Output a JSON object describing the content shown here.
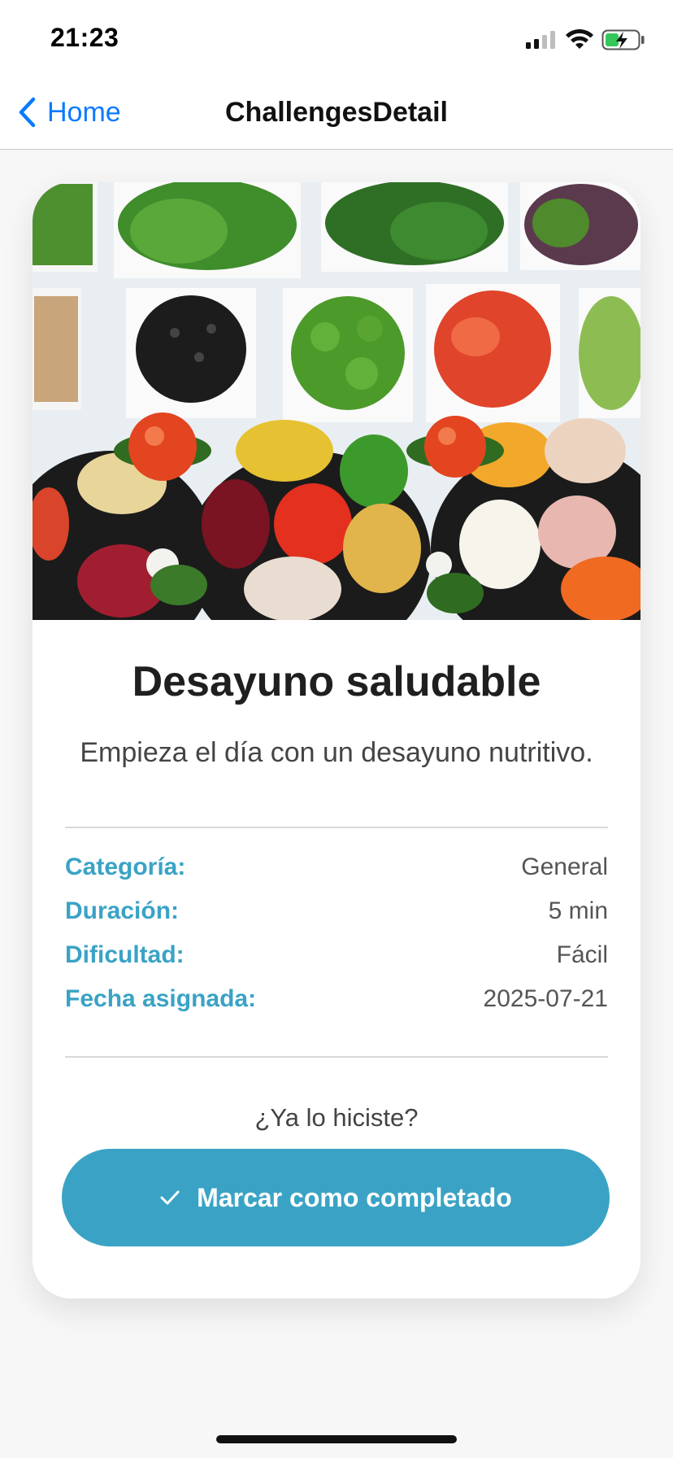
{
  "status_bar": {
    "time": "21:23"
  },
  "nav": {
    "back_label": "Home",
    "title": "ChallengesDetail"
  },
  "challenge": {
    "title": "Desayuno saludable",
    "description": "Empieza el día con un desayuno nutritivo.",
    "details": [
      {
        "label": "Categoría:",
        "value": "General"
      },
      {
        "label": "Duración:",
        "value": "5 min"
      },
      {
        "label": "Dificultad:",
        "value": "Fácil"
      },
      {
        "label": "Fecha asignada:",
        "value": "2025-07-21"
      }
    ],
    "question": "¿Ya lo hiciste?",
    "cta_label": "Marcar como completado"
  },
  "colors": {
    "accent": "#3aa3c5",
    "ios_blue": "#0a7aff"
  }
}
